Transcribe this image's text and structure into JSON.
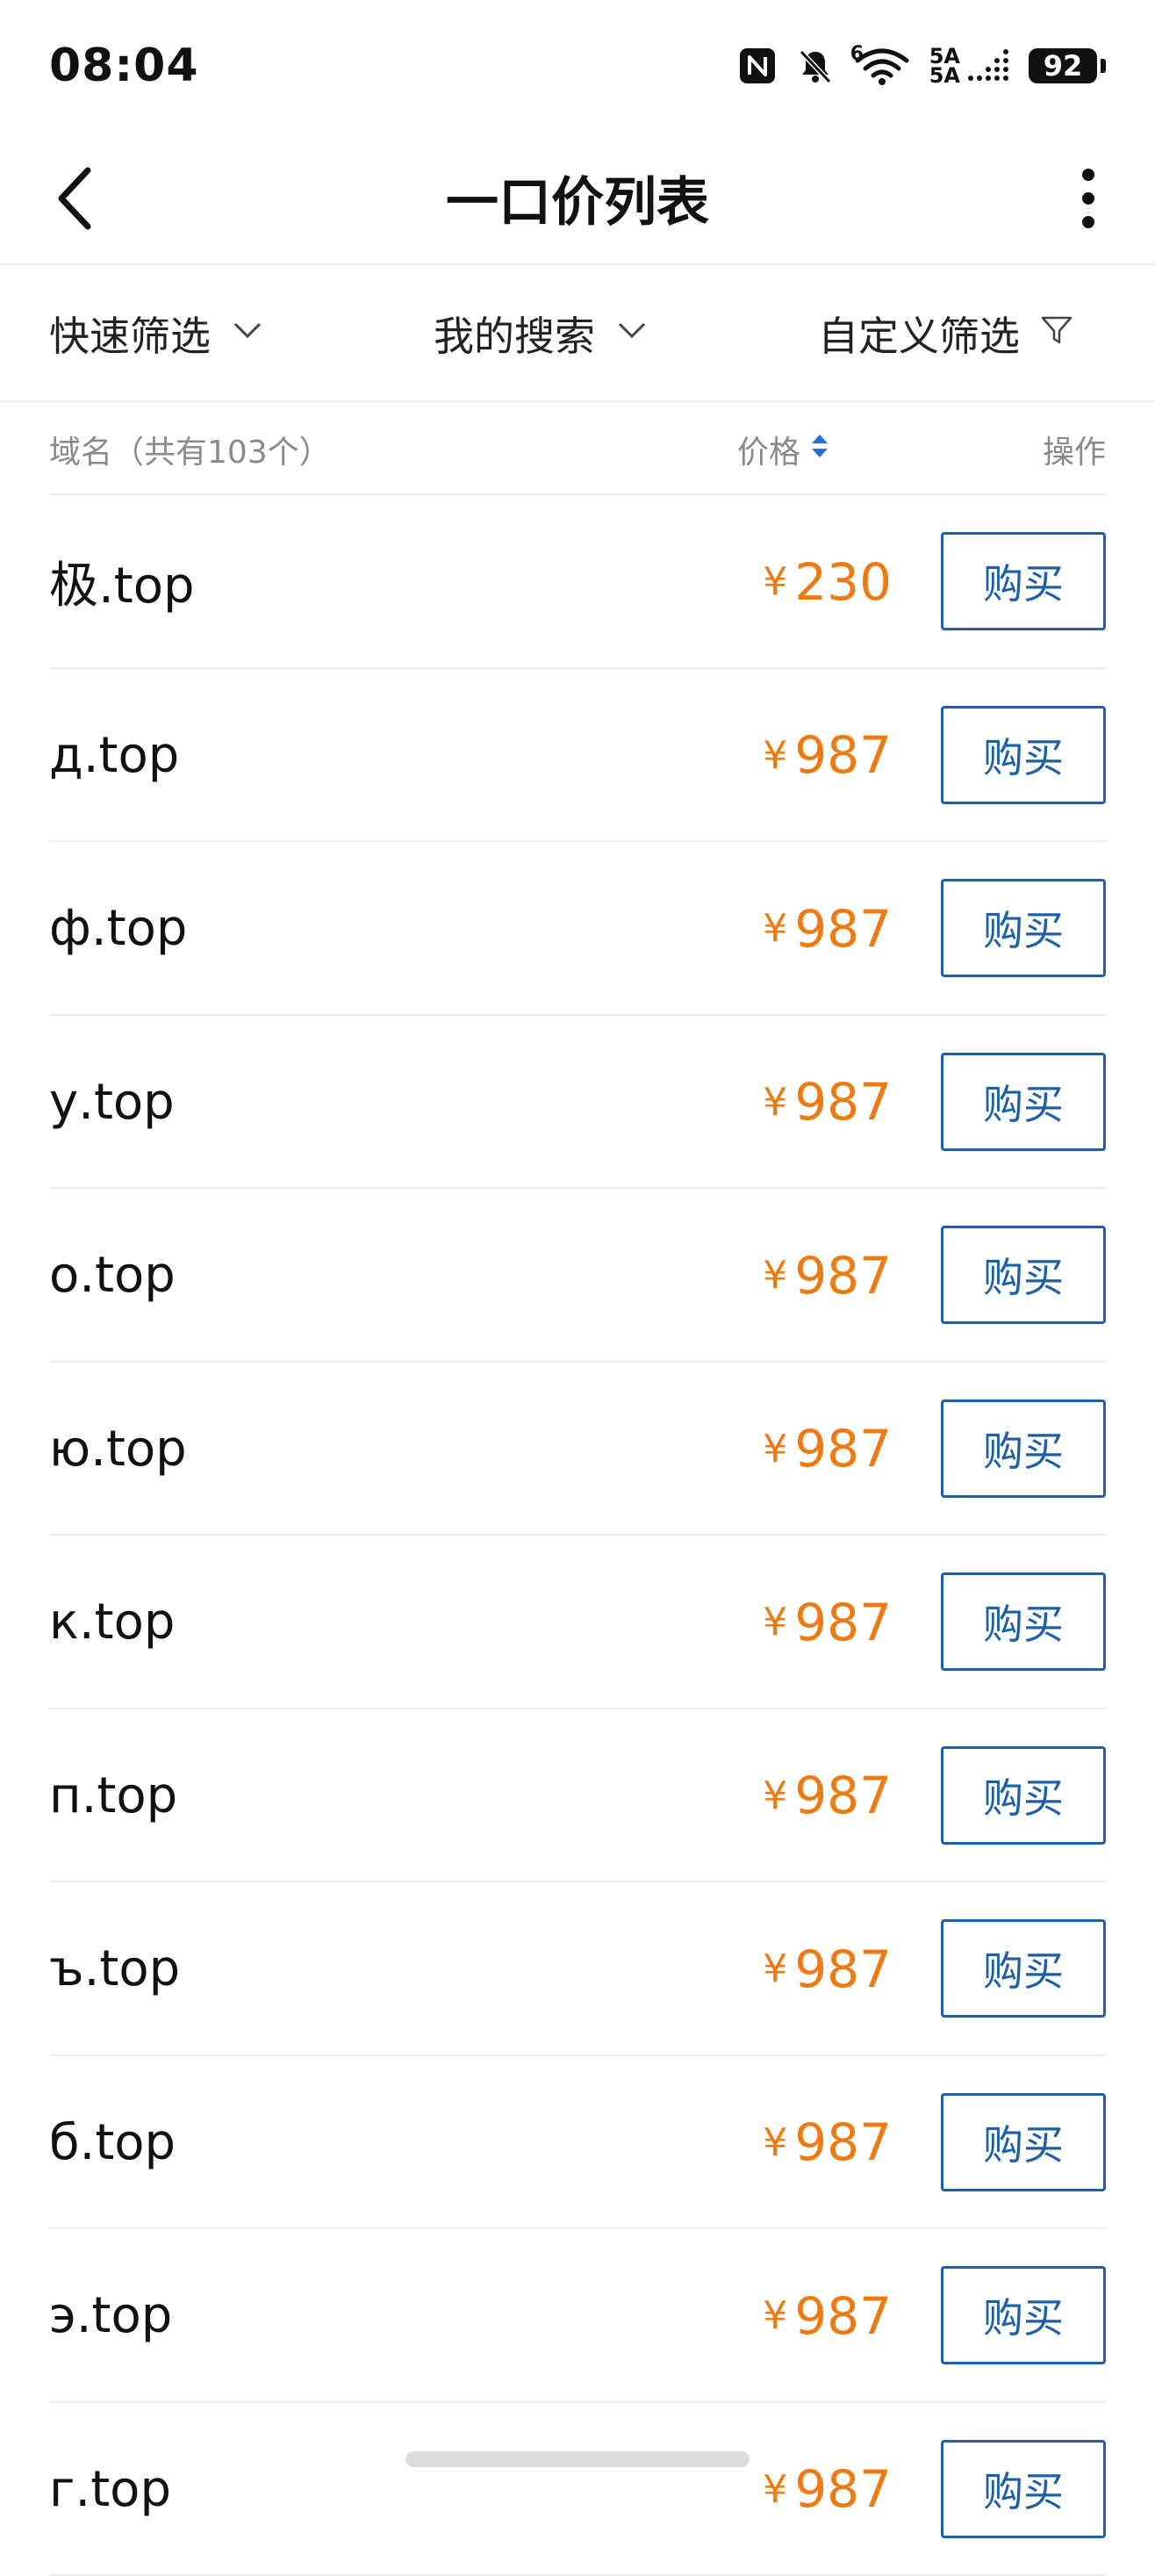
{
  "status_bar": {
    "time": "08:04",
    "network_top": "5A",
    "network_bottom": "5A",
    "wifi_superscript": "6",
    "battery": "92"
  },
  "nav": {
    "title": "一口价列表"
  },
  "filters": [
    {
      "label": "快速筛选",
      "icon": "chevron-down-icon"
    },
    {
      "label": "我的搜索",
      "icon": "chevron-down-icon"
    },
    {
      "label": "自定义筛选",
      "icon": "filter-icon"
    }
  ],
  "table": {
    "header_domain": "域名（共有103个）",
    "header_price": "价格",
    "header_action": "操作",
    "currency_symbol": "¥",
    "buy_label": "购买",
    "rows": [
      {
        "domain": "极.top",
        "price": "230"
      },
      {
        "domain": "д.top",
        "price": "987"
      },
      {
        "domain": "ф.top",
        "price": "987"
      },
      {
        "domain": "у.top",
        "price": "987"
      },
      {
        "domain": "о.top",
        "price": "987"
      },
      {
        "domain": "ю.top",
        "price": "987"
      },
      {
        "domain": "к.top",
        "price": "987"
      },
      {
        "domain": "п.top",
        "price": "987"
      },
      {
        "domain": "ъ.top",
        "price": "987"
      },
      {
        "domain": "б.top",
        "price": "987"
      },
      {
        "domain": "э.top",
        "price": "987"
      },
      {
        "domain": "г.top",
        "price": "987"
      }
    ]
  },
  "colors": {
    "price": "#ee7a12",
    "buy_button": "#1d5fa8",
    "sort_icon": "#2b6fd6"
  }
}
